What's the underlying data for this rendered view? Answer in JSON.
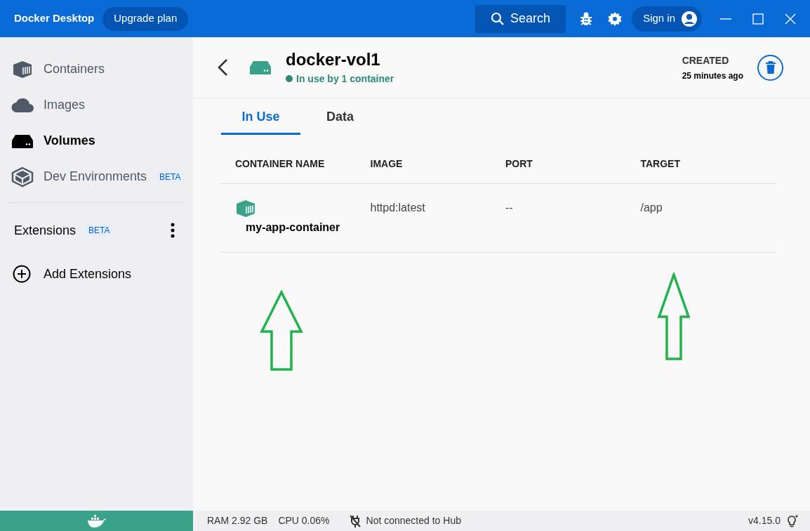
{
  "title_bar": {
    "app_name": "Docker Desktop",
    "upgrade_button": "Upgrade plan",
    "search_button": "Search",
    "sign_in_button": "Sign in"
  },
  "sidebar": {
    "items": [
      {
        "label": "Containers",
        "selected": false
      },
      {
        "label": "Images",
        "selected": false
      },
      {
        "label": "Volumes",
        "selected": true
      },
      {
        "label": "Dev Environments",
        "selected": false,
        "badge": "BETA"
      }
    ],
    "extensions": {
      "label": "Extensions",
      "badge": "BETA"
    },
    "add_extensions": "Add Extensions"
  },
  "volume": {
    "name": "docker-vol1",
    "status": "In use by 1 container",
    "created_label": "CREATED",
    "created_value": "25 minutes ago"
  },
  "tabs": [
    {
      "label": "In Use",
      "selected": true
    },
    {
      "label": "Data",
      "selected": false
    }
  ],
  "table": {
    "columns": [
      "CONTAINER NAME",
      "IMAGE",
      "PORT",
      "TARGET"
    ],
    "rows": [
      {
        "container_name": "my-app-container",
        "image": "httpd:latest",
        "port": "--",
        "target": "/app"
      }
    ]
  },
  "status_bar": {
    "ram": "RAM 2.92 GB",
    "cpu": "CPU 0.06%",
    "hub": "Not connected to Hub",
    "version": "v4.15.0"
  }
}
